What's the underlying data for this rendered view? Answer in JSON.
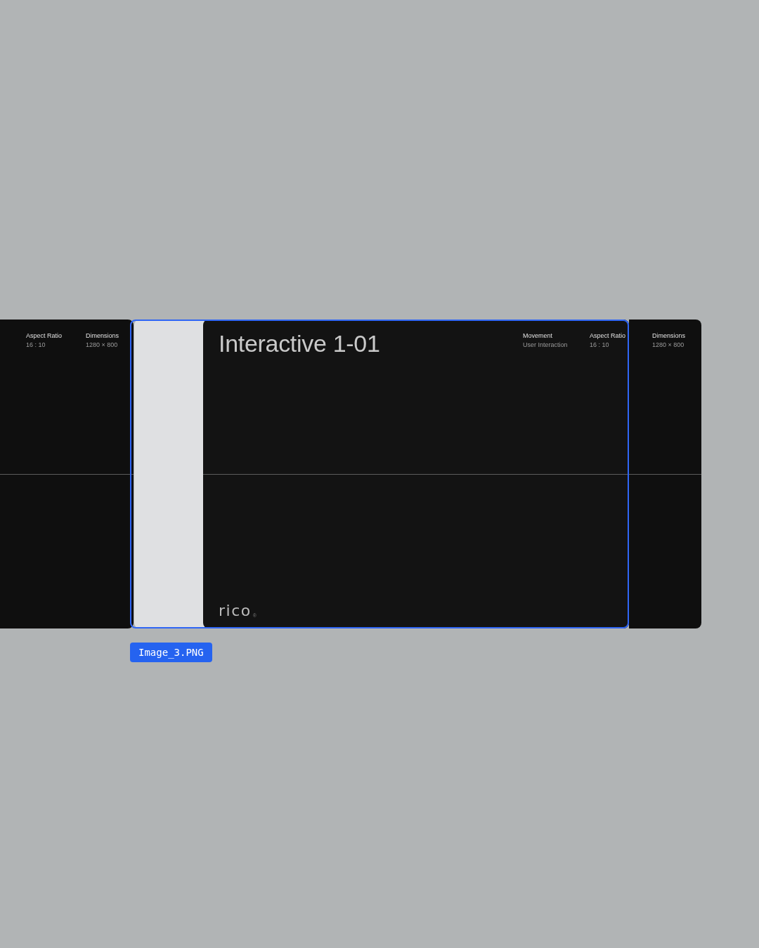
{
  "previous_card": {
    "meta": [
      {
        "label": "Aspect Ratio",
        "value": "16 : 10"
      },
      {
        "label": "Dimensions",
        "value": "1280 × 800"
      }
    ]
  },
  "current_card": {
    "title": "Interactive 1-01",
    "meta": [
      {
        "label": "Movement",
        "value": "User Interaction"
      },
      {
        "label": "Aspect Ratio",
        "value": "16 : 10"
      }
    ],
    "logo": "rico",
    "logo_mark": "®"
  },
  "next_card": {
    "meta": [
      {
        "label": "Dimensions",
        "value": "1280 × 800"
      }
    ]
  },
  "selection": {
    "label": "Image_3.PNG"
  }
}
